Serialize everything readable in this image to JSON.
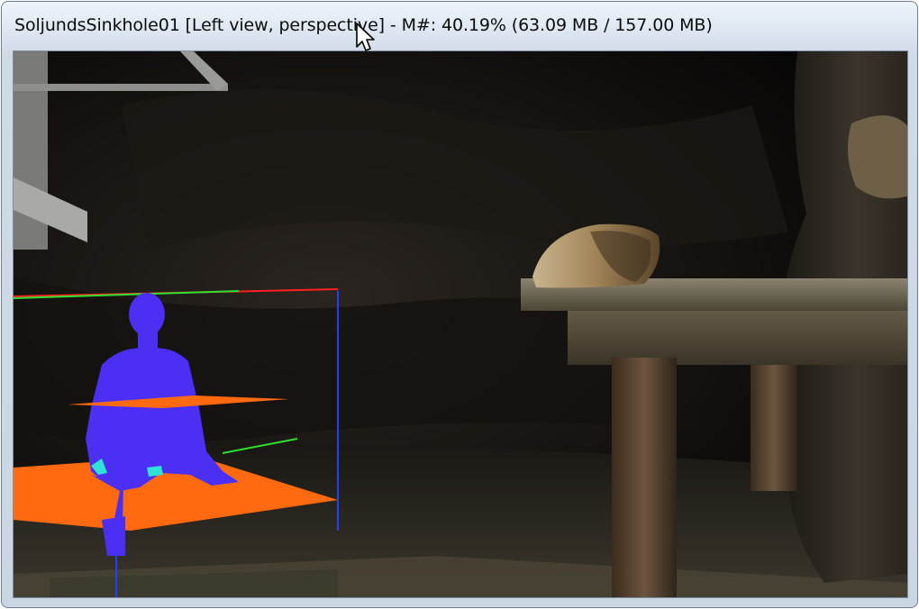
{
  "window": {
    "title": "SoljundsSinkhole01 [Left view, perspective] - M#: 40.19% (63.09 MB / 157.00 MB)"
  },
  "viewport": {
    "view": "Left view, perspective",
    "scene_objects": {
      "selected_figure": "blue-human-figure",
      "gizmo_planes": [
        "orange-ground-plane",
        "orange-upper-plane"
      ],
      "props": [
        "wooden-table",
        "parchment-scroll",
        "stone-pillar",
        "cave-floor"
      ]
    }
  },
  "colors": {
    "figure": "#4b2ff2",
    "plane": "#ff6a10",
    "highlight": "#2ee2d8",
    "axis_x": "#ff2020",
    "axis_y": "#30e030",
    "axis_z": "#2040ff",
    "window_frame": "#cbd6e3"
  },
  "icons": {
    "cursor": "mouse-pointer-icon"
  }
}
